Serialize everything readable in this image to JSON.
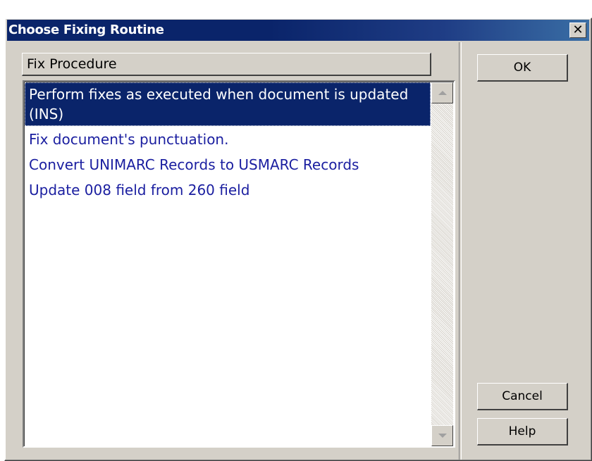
{
  "window": {
    "title": "Choose Fixing Routine",
    "close_symbol": "✕"
  },
  "list": {
    "column_header": "Fix Procedure",
    "items": [
      {
        "label": "Perform fixes as executed when document is updated (INS)",
        "selected": true
      },
      {
        "label": "Fix document's punctuation.",
        "selected": false
      },
      {
        "label": "Convert UNIMARC Records to USMARC Records",
        "selected": false
      },
      {
        "label": "Update 008 field from 260 field",
        "selected": false
      }
    ]
  },
  "buttons": {
    "ok": "OK",
    "cancel": "Cancel",
    "help": "Help"
  },
  "colors": {
    "titlebar": "#0a246a",
    "selection": "#0a246a",
    "item_text": "#1a1ea0",
    "dialog_face": "#d4d0c8"
  },
  "icons": {
    "close": "close-icon",
    "scroll_up": "scroll-up-arrow-icon",
    "scroll_down": "scroll-down-arrow-icon"
  }
}
